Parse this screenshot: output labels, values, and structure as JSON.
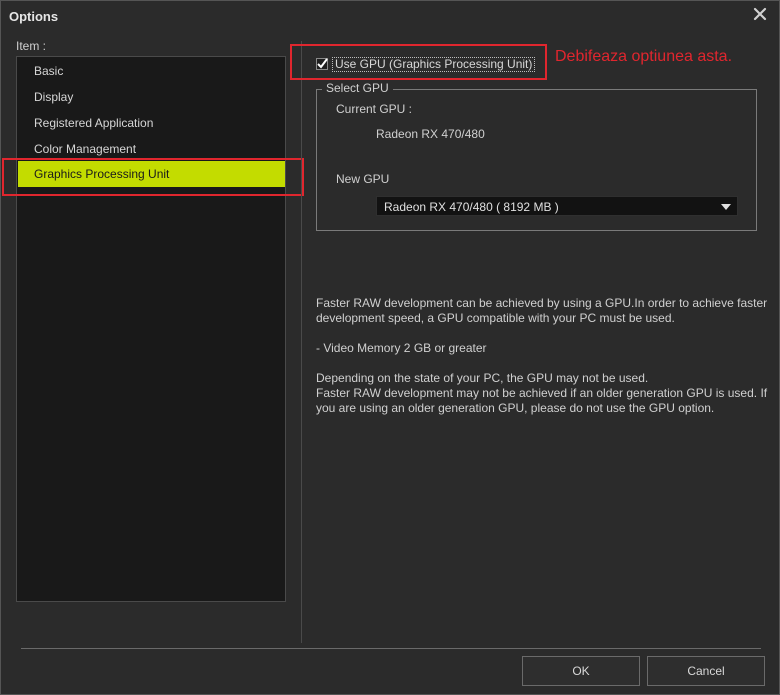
{
  "window": {
    "title": "Options"
  },
  "sidebar": {
    "label": "Item :",
    "items": [
      {
        "label": "Basic"
      },
      {
        "label": "Display"
      },
      {
        "label": "Registered Application"
      },
      {
        "label": "Color Management"
      },
      {
        "label": "Graphics Processing Unit",
        "selected": true
      }
    ]
  },
  "gpu": {
    "use_gpu_label": "Use GPU (Graphics Processing Unit)",
    "use_gpu_checked": true,
    "annotation": "Debifeaza optiunea asta.",
    "select_group_title": "Select GPU",
    "current_gpu_label": "Current GPU :",
    "current_gpu_value": "Radeon RX 470/480",
    "new_gpu_label": "New GPU",
    "new_gpu_selected": "Radeon RX 470/480 ( 8192 MB )"
  },
  "description": {
    "line1": "Faster RAW development can be achieved by using a GPU.In order to achieve faster",
    "line2": "development speed, a GPU compatible with your PC must be used.",
    "line3": " - Video Memory 2 GB or greater",
    "line4": "Depending on the state of your PC, the GPU may not be used.",
    "line5": "Faster RAW development may not be achieved if an older generation GPU is used. If",
    "line6": "you are using an older generation GPU, please do not use the GPU option."
  },
  "footer": {
    "ok_label": "OK",
    "cancel_label": "Cancel"
  },
  "colors": {
    "selected_bg": "#c3dc00",
    "annotation": "#e0262e",
    "window_bg": "#2b2b2b"
  }
}
